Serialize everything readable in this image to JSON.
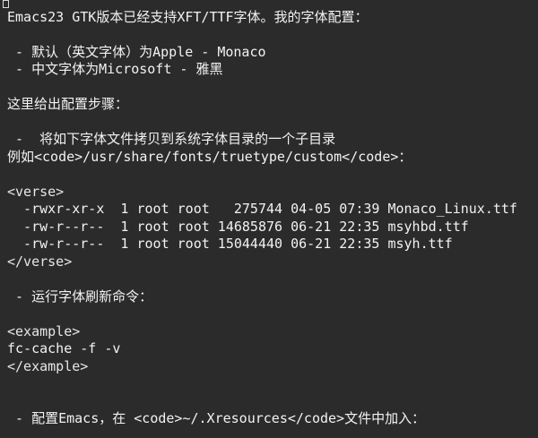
{
  "editor": {
    "lines": [
      "Emacs23 GTK版本已经支持XFT/TTF字体。我的字体配置：",
      "",
      " - 默认（英文字体）为Apple - Monaco",
      " - 中文字体为Microsoft - 雅黑",
      "",
      "这里给出配置步骤：",
      "",
      " -  将如下字体文件拷贝到系统字体目录的一个子目录",
      "例如<code>/usr/share/fonts/truetype/custom</code>：",
      "",
      "<verse>",
      "  -rwxr-xr-x  1 root root   275744 04-05 07:39 Monaco_Linux.ttf",
      "  -rw-r--r--  1 root root 14685876 06-21 22:35 msyhbd.ttf",
      "  -rw-r--r--  1 root root 15044440 06-21 22:35 msyh.ttf",
      "</verse>",
      "",
      " - 运行字体刷新命令：",
      "",
      "<example>",
      "fc-cache -f -v",
      "</example>",
      "",
      "",
      " - 配置Emacs，在 <code>~/.Xresources</code>文件中加入："
    ]
  }
}
